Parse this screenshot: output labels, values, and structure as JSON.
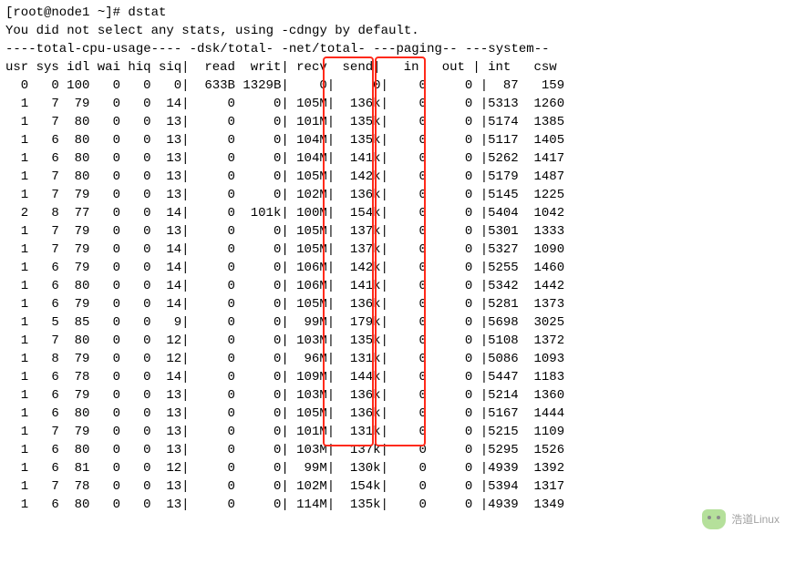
{
  "prompt": "[root@node1 ~]# dstat",
  "default_msg": "You did not select any stats, using -cdngy by default.",
  "group_header": "----total-cpu-usage---- -dsk/total- -net/total- ---paging-- ---system--",
  "columns": {
    "usr": "usr",
    "sys": "sys",
    "idl": "idl",
    "wai": "wai",
    "hiq": "hiq",
    "siq": "siq",
    "read": "read",
    "writ": "writ",
    "recv": "recv",
    "send": "send",
    "in": "in",
    "out": "out",
    "int": "int",
    "csw": "csw"
  },
  "highlight_columns": [
    "recv",
    "send"
  ],
  "watermark": "浩道Linux",
  "rows": [
    {
      "usr": "0",
      "sys": "0",
      "idl": "100",
      "wai": "0",
      "hiq": "0",
      "siq": "0",
      "read": "633B",
      "writ": "1329B",
      "recv": "0",
      "send": "0",
      "in": "0",
      "out": "0",
      "int": "87",
      "csw": "159"
    },
    {
      "usr": "1",
      "sys": "7",
      "idl": "79",
      "wai": "0",
      "hiq": "0",
      "siq": "14",
      "read": "0",
      "writ": "0",
      "recv": "105M",
      "send": "136k",
      "in": "0",
      "out": "0",
      "int": "5313",
      "csw": "1260"
    },
    {
      "usr": "1",
      "sys": "7",
      "idl": "80",
      "wai": "0",
      "hiq": "0",
      "siq": "13",
      "read": "0",
      "writ": "0",
      "recv": "101M",
      "send": "135k",
      "in": "0",
      "out": "0",
      "int": "5174",
      "csw": "1385"
    },
    {
      "usr": "1",
      "sys": "6",
      "idl": "80",
      "wai": "0",
      "hiq": "0",
      "siq": "13",
      "read": "0",
      "writ": "0",
      "recv": "104M",
      "send": "135k",
      "in": "0",
      "out": "0",
      "int": "5117",
      "csw": "1405"
    },
    {
      "usr": "1",
      "sys": "6",
      "idl": "80",
      "wai": "0",
      "hiq": "0",
      "siq": "13",
      "read": "0",
      "writ": "0",
      "recv": "104M",
      "send": "141k",
      "in": "0",
      "out": "0",
      "int": "5262",
      "csw": "1417"
    },
    {
      "usr": "1",
      "sys": "7",
      "idl": "80",
      "wai": "0",
      "hiq": "0",
      "siq": "13",
      "read": "0",
      "writ": "0",
      "recv": "105M",
      "send": "142k",
      "in": "0",
      "out": "0",
      "int": "5179",
      "csw": "1487"
    },
    {
      "usr": "1",
      "sys": "7",
      "idl": "79",
      "wai": "0",
      "hiq": "0",
      "siq": "13",
      "read": "0",
      "writ": "0",
      "recv": "102M",
      "send": "136k",
      "in": "0",
      "out": "0",
      "int": "5145",
      "csw": "1225"
    },
    {
      "usr": "2",
      "sys": "8",
      "idl": "77",
      "wai": "0",
      "hiq": "0",
      "siq": "14",
      "read": "0",
      "writ": "101k",
      "recv": "100M",
      "send": "154k",
      "in": "0",
      "out": "0",
      "int": "5404",
      "csw": "1042"
    },
    {
      "usr": "1",
      "sys": "7",
      "idl": "79",
      "wai": "0",
      "hiq": "0",
      "siq": "13",
      "read": "0",
      "writ": "0",
      "recv": "105M",
      "send": "137k",
      "in": "0",
      "out": "0",
      "int": "5301",
      "csw": "1333"
    },
    {
      "usr": "1",
      "sys": "7",
      "idl": "79",
      "wai": "0",
      "hiq": "0",
      "siq": "14",
      "read": "0",
      "writ": "0",
      "recv": "105M",
      "send": "137k",
      "in": "0",
      "out": "0",
      "int": "5327",
      "csw": "1090"
    },
    {
      "usr": "1",
      "sys": "6",
      "idl": "79",
      "wai": "0",
      "hiq": "0",
      "siq": "14",
      "read": "0",
      "writ": "0",
      "recv": "106M",
      "send": "142k",
      "in": "0",
      "out": "0",
      "int": "5255",
      "csw": "1460"
    },
    {
      "usr": "1",
      "sys": "6",
      "idl": "80",
      "wai": "0",
      "hiq": "0",
      "siq": "14",
      "read": "0",
      "writ": "0",
      "recv": "106M",
      "send": "141k",
      "in": "0",
      "out": "0",
      "int": "5342",
      "csw": "1442"
    },
    {
      "usr": "1",
      "sys": "6",
      "idl": "79",
      "wai": "0",
      "hiq": "0",
      "siq": "14",
      "read": "0",
      "writ": "0",
      "recv": "105M",
      "send": "136k",
      "in": "0",
      "out": "0",
      "int": "5281",
      "csw": "1373"
    },
    {
      "usr": "1",
      "sys": "5",
      "idl": "85",
      "wai": "0",
      "hiq": "0",
      "siq": "9",
      "read": "0",
      "writ": "0",
      "recv": "99M",
      "send": "179k",
      "in": "0",
      "out": "0",
      "int": "5698",
      "csw": "3025"
    },
    {
      "usr": "1",
      "sys": "7",
      "idl": "80",
      "wai": "0",
      "hiq": "0",
      "siq": "12",
      "read": "0",
      "writ": "0",
      "recv": "103M",
      "send": "135k",
      "in": "0",
      "out": "0",
      "int": "5108",
      "csw": "1372"
    },
    {
      "usr": "1",
      "sys": "8",
      "idl": "79",
      "wai": "0",
      "hiq": "0",
      "siq": "12",
      "read": "0",
      "writ": "0",
      "recv": "96M",
      "send": "131k",
      "in": "0",
      "out": "0",
      "int": "5086",
      "csw": "1093"
    },
    {
      "usr": "1",
      "sys": "6",
      "idl": "78",
      "wai": "0",
      "hiq": "0",
      "siq": "14",
      "read": "0",
      "writ": "0",
      "recv": "109M",
      "send": "144k",
      "in": "0",
      "out": "0",
      "int": "5447",
      "csw": "1183"
    },
    {
      "usr": "1",
      "sys": "6",
      "idl": "79",
      "wai": "0",
      "hiq": "0",
      "siq": "13",
      "read": "0",
      "writ": "0",
      "recv": "103M",
      "send": "136k",
      "in": "0",
      "out": "0",
      "int": "5214",
      "csw": "1360"
    },
    {
      "usr": "1",
      "sys": "6",
      "idl": "80",
      "wai": "0",
      "hiq": "0",
      "siq": "13",
      "read": "0",
      "writ": "0",
      "recv": "105M",
      "send": "136k",
      "in": "0",
      "out": "0",
      "int": "5167",
      "csw": "1444"
    },
    {
      "usr": "1",
      "sys": "7",
      "idl": "79",
      "wai": "0",
      "hiq": "0",
      "siq": "13",
      "read": "0",
      "writ": "0",
      "recv": "101M",
      "send": "131k",
      "in": "0",
      "out": "0",
      "int": "5215",
      "csw": "1109"
    },
    {
      "usr": "1",
      "sys": "6",
      "idl": "80",
      "wai": "0",
      "hiq": "0",
      "siq": "13",
      "read": "0",
      "writ": "0",
      "recv": "103M",
      "send": "137k",
      "in": "0",
      "out": "0",
      "int": "5295",
      "csw": "1526"
    },
    {
      "usr": "1",
      "sys": "6",
      "idl": "81",
      "wai": "0",
      "hiq": "0",
      "siq": "12",
      "read": "0",
      "writ": "0",
      "recv": "99M",
      "send": "130k",
      "in": "0",
      "out": "0",
      "int": "4939",
      "csw": "1392"
    },
    {
      "usr": "1",
      "sys": "7",
      "idl": "78",
      "wai": "0",
      "hiq": "0",
      "siq": "13",
      "read": "0",
      "writ": "0",
      "recv": "102M",
      "send": "154k",
      "in": "0",
      "out": "0",
      "int": "5394",
      "csw": "1317"
    },
    {
      "usr": "1",
      "sys": "6",
      "idl": "80",
      "wai": "0",
      "hiq": "0",
      "siq": "13",
      "read": "0",
      "writ": "0",
      "recv": "114M",
      "send": "135k",
      "in": "0",
      "out": "0",
      "int": "4939",
      "csw": "1349"
    }
  ]
}
